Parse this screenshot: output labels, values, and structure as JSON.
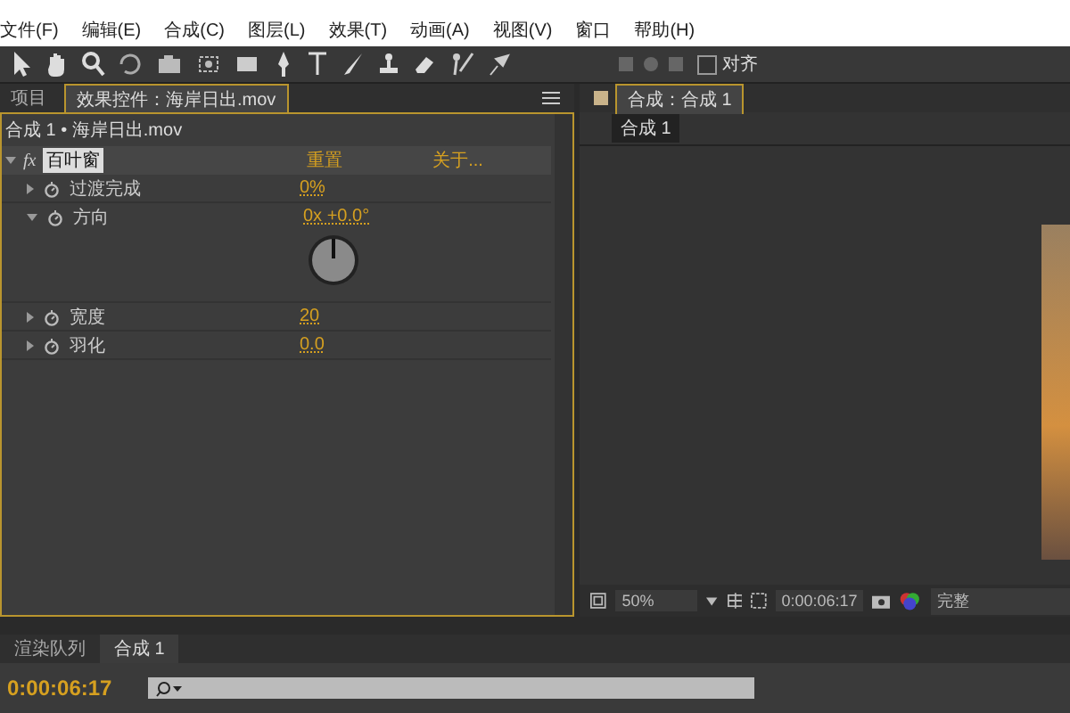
{
  "menu": [
    "文件(F)",
    "编辑(E)",
    "合成(C)",
    "图层(L)",
    "效果(T)",
    "动画(A)",
    "视图(V)",
    "窗口",
    "帮助(H)"
  ],
  "toolbar": {
    "snap": {
      "label": "对齐",
      "checked": false
    }
  },
  "effects_panel": {
    "tabs": [
      {
        "label": "项目",
        "selected": false
      },
      {
        "label": "效果控件：海岸日出.mov",
        "selected": true
      }
    ],
    "breadcrumb": "合成 1 • 海岸日出.mov",
    "effect": {
      "badge": "fx",
      "name": "百叶窗",
      "expanded": true,
      "reset": "重置",
      "about": "关于..."
    },
    "properties": [
      {
        "name": "过渡完成",
        "value": "0%",
        "expanded": false,
        "kind": "value"
      },
      {
        "name": "方向",
        "value": "0x +0.0°",
        "expanded": true,
        "kind": "dial"
      },
      {
        "name": "宽度",
        "value": "20",
        "expanded": false,
        "kind": "value"
      },
      {
        "name": "羽化",
        "value": "0.0",
        "expanded": false,
        "kind": "value"
      }
    ]
  },
  "composition_panel": {
    "tab": "合成：合成 1",
    "subtab": "合成 1",
    "zoom": "50%",
    "timecode": "0:00:06:17",
    "quality": "完整"
  },
  "timeline": {
    "tabs": [
      {
        "label": "渲染队列",
        "selected": false
      },
      {
        "label": "合成 1",
        "selected": true
      }
    ],
    "timecode": "0:00:06:17"
  }
}
